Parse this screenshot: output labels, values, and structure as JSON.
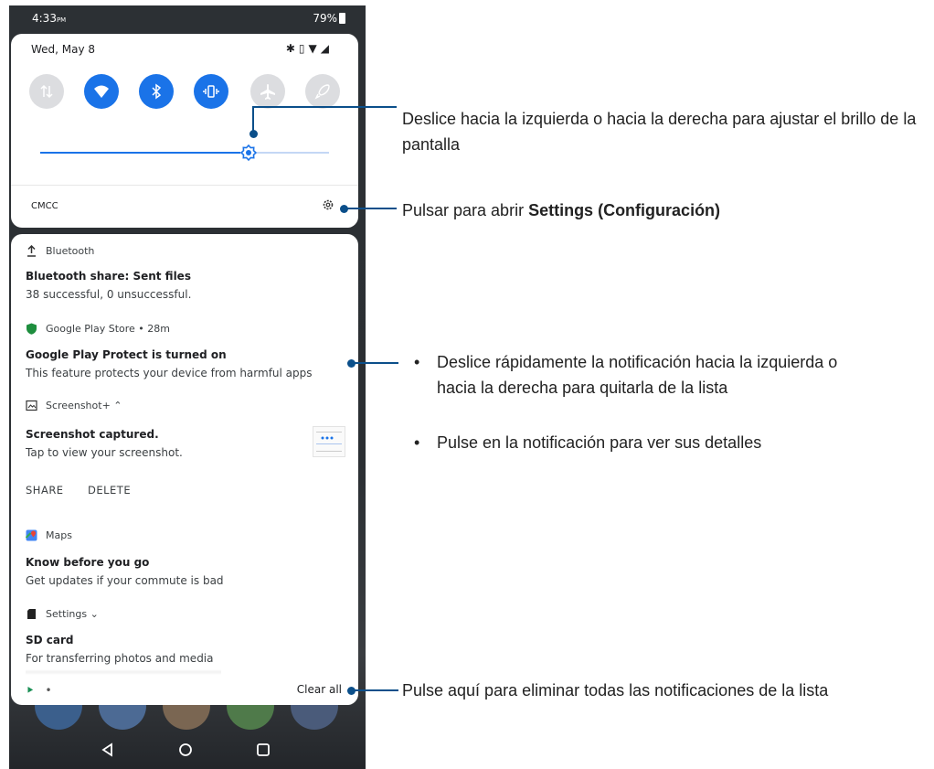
{
  "status_bar": {
    "time": "4:33",
    "ampm": "PM",
    "battery": "79%"
  },
  "quick_settings": {
    "date": "Wed, May 8",
    "carrier": "CMCC",
    "brightness_level": 0.72,
    "tiles": [
      {
        "name": "mobile-data",
        "state": "off"
      },
      {
        "name": "wifi",
        "state": "on"
      },
      {
        "name": "bluetooth",
        "state": "on"
      },
      {
        "name": "vibrate",
        "state": "on"
      },
      {
        "name": "airplane-mode",
        "state": "off"
      },
      {
        "name": "rocket",
        "state": "off"
      }
    ]
  },
  "notifications": {
    "bluetooth": {
      "app": "Bluetooth",
      "title": "Bluetooth share: Sent files",
      "text": "38 successful, 0 unsuccessful."
    },
    "play": {
      "app": "Google Play Store • 28m",
      "title": "Google Play Protect is turned on",
      "text": "This feature protects your device from harmful apps"
    },
    "screenshot": {
      "app": "Screenshot+ ⌃",
      "title": "Screenshot captured.",
      "text": "Tap to view your screenshot.",
      "action_share": "SHARE",
      "action_delete": "DELETE"
    },
    "maps": {
      "app": "Maps",
      "title": "Know before you go",
      "text": "Get updates if your commute is bad"
    },
    "settings": {
      "app": "Settings ⌄",
      "title": "SD card",
      "text": "For transferring photos and media"
    },
    "bottom_dot": "•",
    "clear_all": "Clear all"
  },
  "annotations": {
    "brightness": "Deslice hacia la izquierda o hacia la derecha para ajustar el brillo de la pantalla",
    "settings_prefix": "Pulsar para abrir ",
    "settings_bold": "Settings (Configuración)",
    "swipe": "Deslice rápidamente la notificación hacia la izquierda o hacia la derecha para quitarla de la lista",
    "tap": "Pulse en la notificación para ver sus detalles",
    "clear": "Pulse aquí para eliminar todas las notificaciones de la lista"
  },
  "colors": {
    "accent": "#1a73e8",
    "annotation": "#0b4f8a"
  }
}
